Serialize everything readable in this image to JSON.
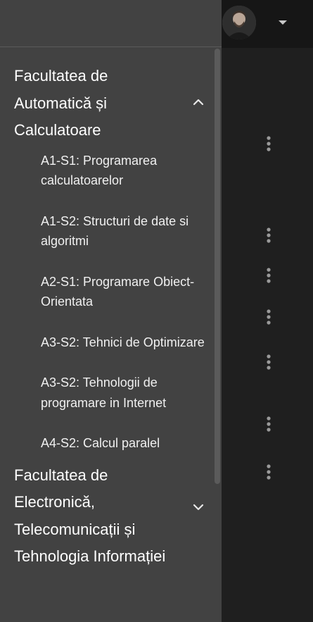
{
  "appbar": {
    "avatar_icon": "user-avatar",
    "menu_icon": "caret-down-icon"
  },
  "drawer": {
    "faculties": [
      {
        "name": "Facultatea de Automatică și Calculatoare",
        "expanded": true,
        "toggle_icon": "chevron-up-icon",
        "courses": [
          "A1-S1: Programarea calculatoarelor",
          "A1-S2: Structuri de date si algoritmi",
          "A2-S1: Programare Obiect-Orientata",
          "A3-S2: Tehnici de Optimizare",
          "A3-S2: Tehnologii de programare in Internet",
          "A4-S2: Calcul paralel"
        ]
      },
      {
        "name": "Facultatea de Electronică, Telecomunicații și Tehnologia Informației",
        "expanded": false,
        "toggle_icon": "chevron-down-icon",
        "courses": []
      }
    ]
  },
  "colors": {
    "drawer_bg": "#424242",
    "app_bg": "#1f1f1f",
    "appbar_bg": "#161616",
    "text_primary": "#ffffff"
  }
}
